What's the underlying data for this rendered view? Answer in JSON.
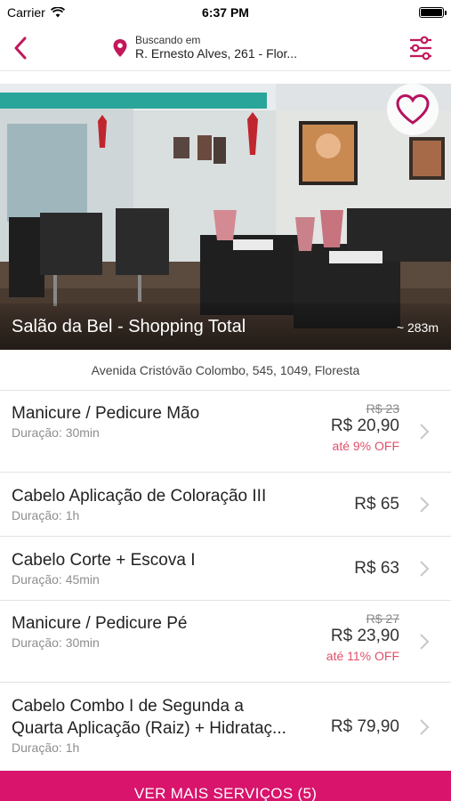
{
  "status_bar": {
    "carrier": "Carrier",
    "time": "6:37 PM",
    "battery_level": 1.0
  },
  "header": {
    "searching_label": "Buscando em",
    "address": "R. Ernesto Alves, 261 - Flor...",
    "back_icon": "chevron-left-icon",
    "filter_icon": "sliders-icon",
    "accent_color": "#c2185b"
  },
  "salon": {
    "name": "Salão da Bel - Shopping Total",
    "distance": "~ 283m",
    "address": "Avenida Cristóvão Colombo, 545, 1049, Floresta",
    "favorite_icon": "heart-icon"
  },
  "services": [
    {
      "name": "Manicure / Pedicure Mão",
      "duration": "Duração: 30min",
      "old_price": "R$ 23",
      "price": "R$ 20,90",
      "discount": "até 9% OFF"
    },
    {
      "name": "Cabelo Aplicação de Coloração III",
      "duration": "Duração: 1h",
      "old_price": "",
      "price": "R$ 65",
      "discount": ""
    },
    {
      "name": "Cabelo Corte + Escova I",
      "duration": "Duração: 45min",
      "old_price": "",
      "price": "R$ 63",
      "discount": ""
    },
    {
      "name": "Manicure / Pedicure Pé",
      "duration": "Duração: 30min",
      "old_price": "R$ 27",
      "price": "R$ 23,90",
      "discount": "até 11% OFF"
    },
    {
      "name_line1": "Cabelo Combo I de Segunda a",
      "name_line2": "Quarta Aplicação (Raiz) + Hidrataç...",
      "duration": "Duração: 1h",
      "old_price": "",
      "price": "R$ 79,90",
      "discount": ""
    }
  ],
  "footer": {
    "more_button": "VER MAIS SERVIÇOS (5)",
    "button_color": "#d8146c"
  }
}
